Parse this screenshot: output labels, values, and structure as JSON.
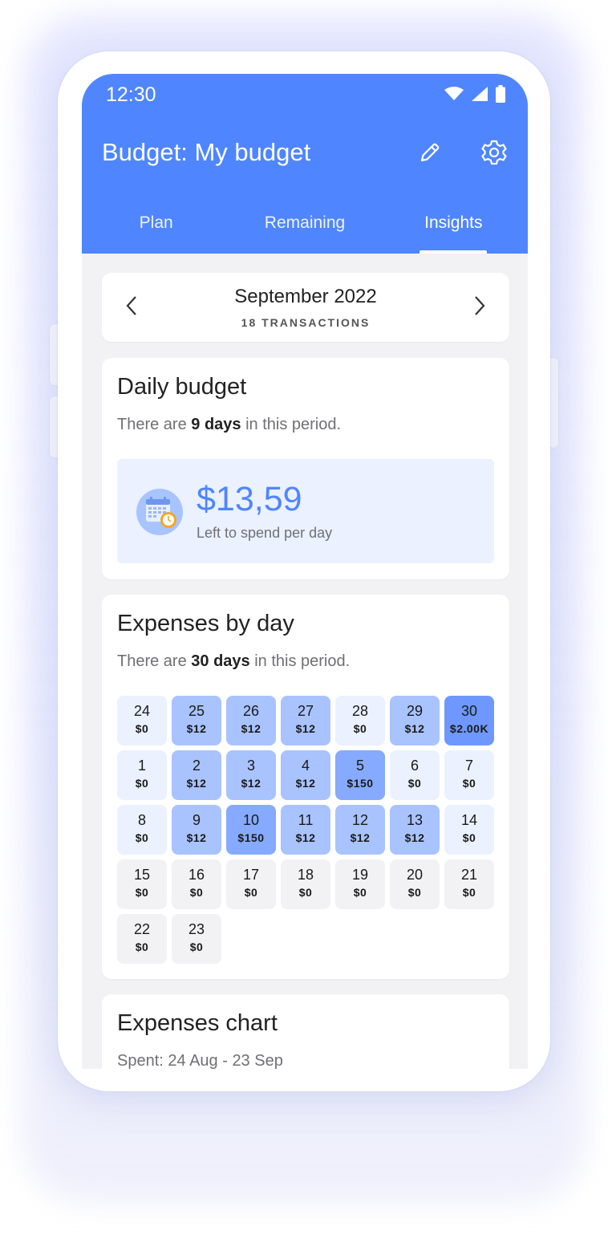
{
  "status_bar": {
    "time": "12:30"
  },
  "app_bar": {
    "title": "Budget: My budget"
  },
  "tabs": [
    {
      "label": "Plan",
      "active": false
    },
    {
      "label": "Remaining",
      "active": false
    },
    {
      "label": "Insights",
      "active": true
    }
  ],
  "period": {
    "title": "September 2022",
    "subtitle": "18 TRANSACTIONS"
  },
  "daily_budget": {
    "title": "Daily budget",
    "sub_prefix": "There are ",
    "sub_bold": "9 days",
    "sub_suffix": " in this period.",
    "amount": "$13,59",
    "label": "Left to spend per day"
  },
  "expenses_by_day": {
    "title": "Expenses by day",
    "sub_prefix": "There are ",
    "sub_bold": "30 days",
    "sub_suffix": " in this period.",
    "days": [
      {
        "day": "24",
        "amount": "$0",
        "level": "past"
      },
      {
        "day": "25",
        "amount": "$12",
        "level": "low"
      },
      {
        "day": "26",
        "amount": "$12",
        "level": "low"
      },
      {
        "day": "27",
        "amount": "$12",
        "level": "low"
      },
      {
        "day": "28",
        "amount": "$0",
        "level": "past"
      },
      {
        "day": "29",
        "amount": "$12",
        "level": "low"
      },
      {
        "day": "30",
        "amount": "$2.00K",
        "level": "high"
      },
      {
        "day": "1",
        "amount": "$0",
        "level": "past"
      },
      {
        "day": "2",
        "amount": "$12",
        "level": "low"
      },
      {
        "day": "3",
        "amount": "$12",
        "level": "low"
      },
      {
        "day": "4",
        "amount": "$12",
        "level": "low"
      },
      {
        "day": "5",
        "amount": "$150",
        "level": "mid"
      },
      {
        "day": "6",
        "amount": "$0",
        "level": "past"
      },
      {
        "day": "7",
        "amount": "$0",
        "level": "past"
      },
      {
        "day": "8",
        "amount": "$0",
        "level": "past"
      },
      {
        "day": "9",
        "amount": "$12",
        "level": "low"
      },
      {
        "day": "10",
        "amount": "$150",
        "level": "mid"
      },
      {
        "day": "11",
        "amount": "$12",
        "level": "low"
      },
      {
        "day": "12",
        "amount": "$12",
        "level": "low"
      },
      {
        "day": "13",
        "amount": "$12",
        "level": "low"
      },
      {
        "day": "14",
        "amount": "$0",
        "level": "past"
      },
      {
        "day": "15",
        "amount": "$0",
        "level": "future"
      },
      {
        "day": "16",
        "amount": "$0",
        "level": "future"
      },
      {
        "day": "17",
        "amount": "$0",
        "level": "future"
      },
      {
        "day": "18",
        "amount": "$0",
        "level": "future"
      },
      {
        "day": "19",
        "amount": "$0",
        "level": "future"
      },
      {
        "day": "20",
        "amount": "$0",
        "level": "future"
      },
      {
        "day": "21",
        "amount": "$0",
        "level": "future"
      },
      {
        "day": "22",
        "amount": "$0",
        "level": "future"
      },
      {
        "day": "23",
        "amount": "$0",
        "level": "future"
      }
    ]
  },
  "expenses_chart": {
    "title": "Expenses chart",
    "subtitle": "Spent: 24 Aug - 23 Sep"
  },
  "colors": {
    "primary": "#4f86ff",
    "cell_past": "#ebf1ff",
    "cell_low": "#a9c3ff",
    "cell_mid": "#86aaff",
    "cell_high": "#6e98ff",
    "cell_future": "#f2f2f4"
  },
  "icons": [
    "wifi-icon",
    "signal-icon",
    "battery-icon",
    "pencil-icon",
    "gear-icon",
    "chevron-left-icon",
    "chevron-right-icon",
    "calendar-clock-icon"
  ]
}
